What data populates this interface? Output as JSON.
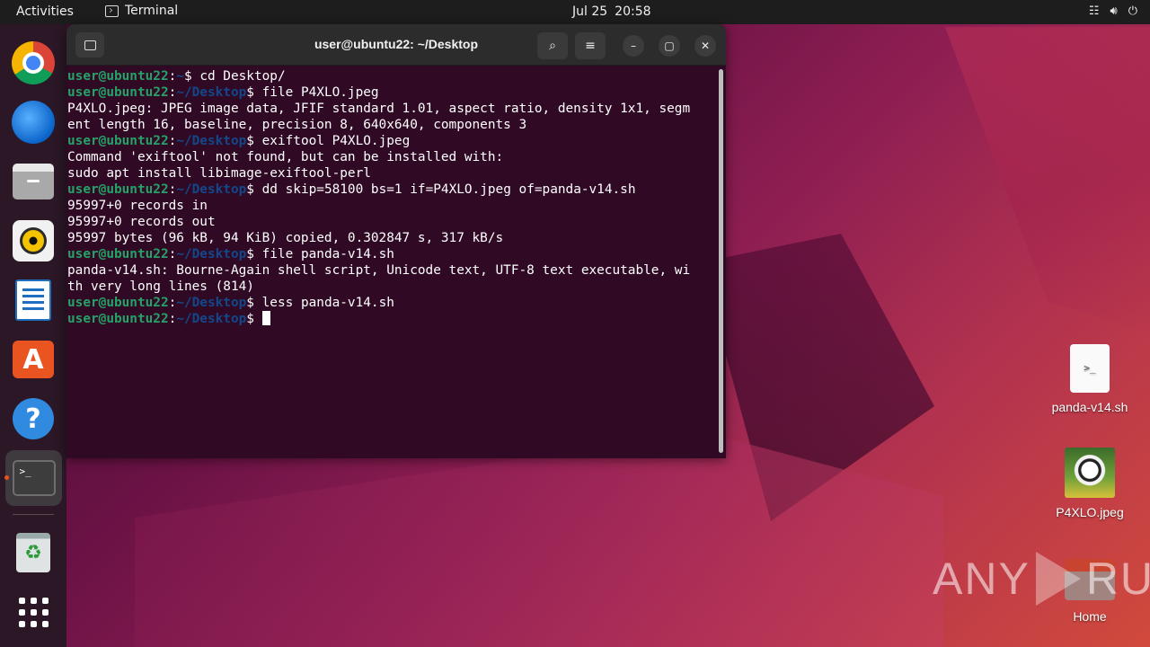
{
  "topbar": {
    "activities": "Activities",
    "app_name": "Terminal",
    "date": "Jul 25",
    "time": "20:58"
  },
  "dock": {
    "items": [
      "Google Chrome",
      "Thunderbird",
      "Files",
      "Rhythmbox",
      "LibreOffice Writer",
      "Ubuntu Software",
      "Help",
      "Terminal",
      "Trash",
      "Show Applications"
    ]
  },
  "terminal": {
    "title": "user@ubuntu22: ~/Desktop",
    "lines": [
      {
        "type": "prompt",
        "user": "user@ubuntu22",
        "path": "~",
        "cmd": " cd Desktop/"
      },
      {
        "type": "prompt",
        "user": "user@ubuntu22",
        "path": "~/Desktop",
        "cmd": " file P4XLO.jpeg"
      },
      {
        "type": "out",
        "text": "P4XLO.jpeg: JPEG image data, JFIF standard 1.01, aspect ratio, density 1x1, segm"
      },
      {
        "type": "out",
        "text": "ent length 16, baseline, precision 8, 640x640, components 3"
      },
      {
        "type": "prompt",
        "user": "user@ubuntu22",
        "path": "~/Desktop",
        "cmd": " exiftool P4XLO.jpeg"
      },
      {
        "type": "out",
        "text": "Command 'exiftool' not found, but can be installed with:"
      },
      {
        "type": "out",
        "text": "sudo apt install libimage-exiftool-perl"
      },
      {
        "type": "prompt",
        "user": "user@ubuntu22",
        "path": "~/Desktop",
        "cmd": " dd skip=58100 bs=1 if=P4XLO.jpeg of=panda-v14.sh"
      },
      {
        "type": "out",
        "text": "95997+0 records in"
      },
      {
        "type": "out",
        "text": "95997+0 records out"
      },
      {
        "type": "out",
        "text": "95997 bytes (96 kB, 94 KiB) copied, 0.302847 s, 317 kB/s"
      },
      {
        "type": "prompt",
        "user": "user@ubuntu22",
        "path": "~/Desktop",
        "cmd": " file panda-v14.sh"
      },
      {
        "type": "out",
        "text": "panda-v14.sh: Bourne-Again shell script, Unicode text, UTF-8 text executable, wi"
      },
      {
        "type": "out",
        "text": "th very long lines (814)"
      },
      {
        "type": "prompt",
        "user": "user@ubuntu22",
        "path": "~/Desktop",
        "cmd": " less panda-v14.sh"
      },
      {
        "type": "prompt",
        "user": "user@ubuntu22",
        "path": "~/Desktop",
        "cmd": " ",
        "cursor": true
      }
    ]
  },
  "desktop": {
    "icons": [
      {
        "label": "panda-v14.sh",
        "glyph": ">_"
      },
      {
        "label": "P4XLO.jpeg"
      },
      {
        "label": "Home"
      }
    ]
  },
  "watermark": {
    "text_left": "ANY",
    "text_right": "RUN"
  }
}
